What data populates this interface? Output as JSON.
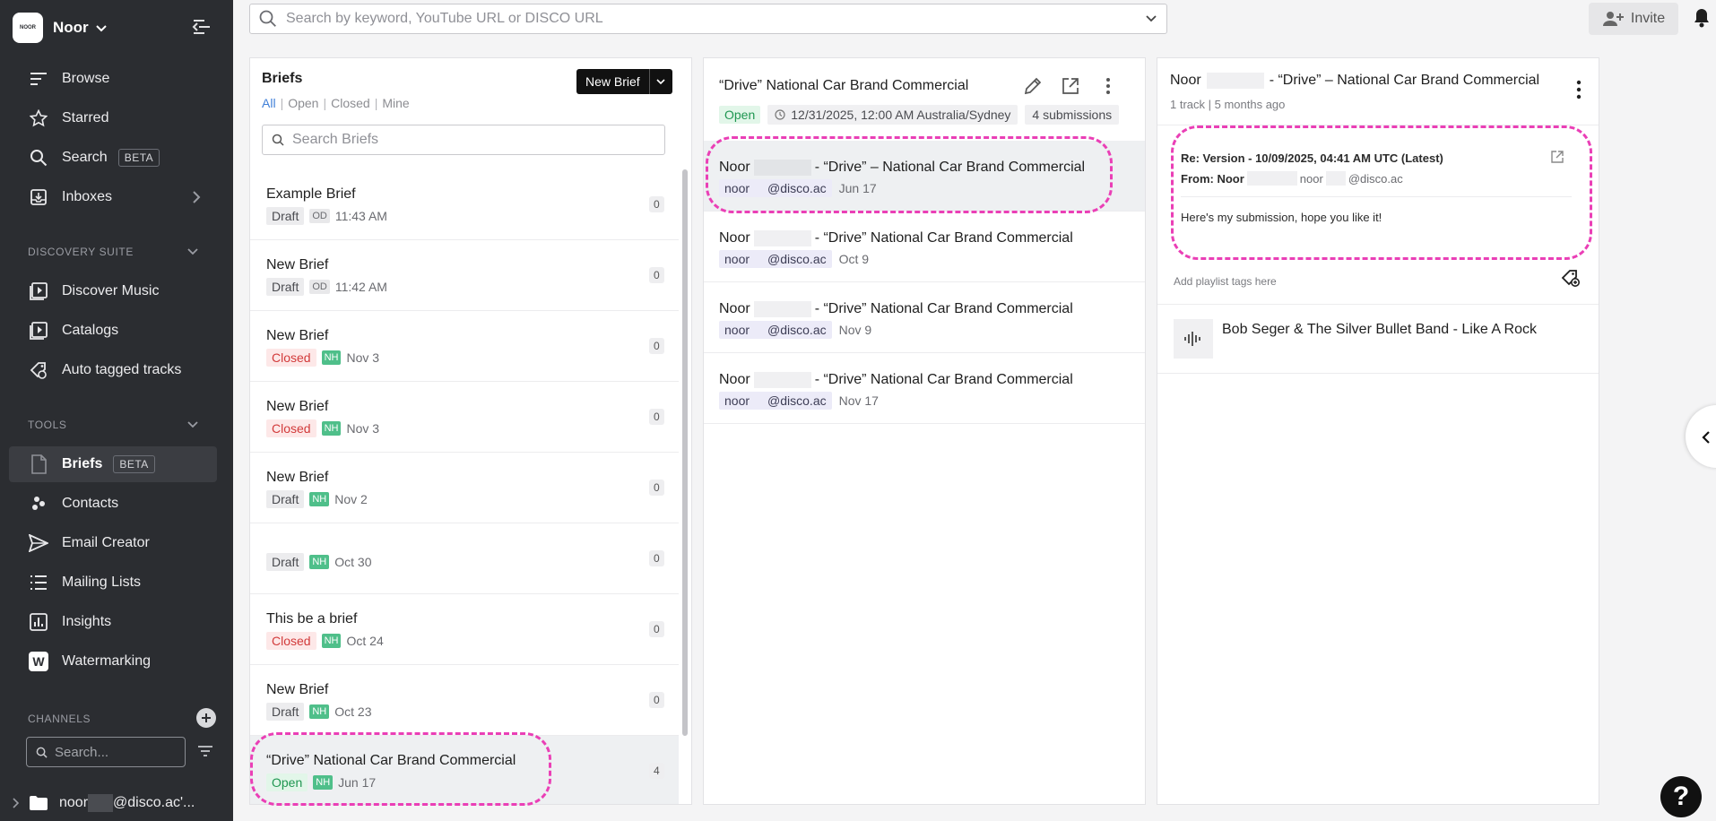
{
  "workspace": {
    "logo_text": "NOOR",
    "name": "Noor"
  },
  "sidebar": {
    "main_items": [
      {
        "label": "Browse",
        "icon": "browse-lines-icon"
      },
      {
        "label": "Starred",
        "icon": "star-icon"
      },
      {
        "label": "Search",
        "icon": "search-icon",
        "badge": "BETA"
      },
      {
        "label": "Inboxes",
        "icon": "inbox-icon"
      }
    ],
    "discovery_title": "DISCOVERY SUITE",
    "discovery_items": [
      {
        "label": "Discover Music",
        "icon": "discover-music-icon"
      },
      {
        "label": "Catalogs",
        "icon": "catalogs-icon"
      },
      {
        "label": "Auto tagged tracks",
        "icon": "auto-tag-icon"
      }
    ],
    "tools_title": "TOOLS",
    "tools_items": [
      {
        "label": "Briefs",
        "icon": "briefs-icon",
        "badge": "BETA",
        "active": true
      },
      {
        "label": "Contacts",
        "icon": "contacts-icon"
      },
      {
        "label": "Email Creator",
        "icon": "send-icon"
      },
      {
        "label": "Mailing Lists",
        "icon": "list-icon"
      },
      {
        "label": "Insights",
        "icon": "insights-icon"
      },
      {
        "label": "Watermarking",
        "icon": "watermark-icon",
        "icon_letter": "W"
      }
    ],
    "channels_title": "CHANNELS",
    "channel_search_placeholder": "Search...",
    "channel_item": {
      "prefix": "noor",
      "suffix": "@disco.ac'..."
    }
  },
  "topbar": {
    "search_placeholder": "Search by keyword, YouTube URL or DISCO URL",
    "invite_label": "Invite"
  },
  "briefs": {
    "title": "Briefs",
    "filters": [
      "All",
      "Open",
      "Closed",
      "Mine"
    ],
    "new_brief_label": "New Brief",
    "search_placeholder": "Search Briefs",
    "rows": [
      {
        "name": "Example Brief",
        "status": "Draft",
        "status_type": "draft",
        "avatar": "OD",
        "avatar_type": "od",
        "date": "11:43 AM",
        "count": "0"
      },
      {
        "name": "New Brief",
        "status": "Draft",
        "status_type": "draft",
        "avatar": "OD",
        "avatar_type": "od",
        "date": "11:42 AM",
        "count": "0"
      },
      {
        "name": "New Brief",
        "status": "Closed",
        "status_type": "closed",
        "avatar": "NH",
        "avatar_type": "nh",
        "date": "Nov 3",
        "count": "0"
      },
      {
        "name": "New Brief",
        "status": "Closed",
        "status_type": "closed",
        "avatar": "NH",
        "avatar_type": "nh",
        "date": "Nov 3",
        "count": "0"
      },
      {
        "name": "New Brief",
        "status": "Draft",
        "status_type": "draft",
        "avatar": "NH",
        "avatar_type": "nh",
        "date": "Nov 2",
        "count": "0"
      },
      {
        "name": "",
        "status": "Draft",
        "status_type": "draft",
        "avatar": "NH",
        "avatar_type": "nh",
        "date": "Oct 30",
        "count": "0"
      },
      {
        "name": "This be a brief",
        "status": "Closed",
        "status_type": "closed",
        "avatar": "NH",
        "avatar_type": "nh",
        "date": "Oct 24",
        "count": "0"
      },
      {
        "name": "New Brief",
        "status": "Draft",
        "status_type": "draft",
        "avatar": "NH",
        "avatar_type": "nh",
        "date": "Oct 23",
        "count": "0"
      },
      {
        "name": "“Drive” National Car Brand Commercial",
        "status": "Open",
        "status_type": "open",
        "avatar": "NH",
        "avatar_type": "nh",
        "date": "Jun 17",
        "count": "4",
        "selected": true
      }
    ]
  },
  "submissions": {
    "title": "“Drive” National Car Brand Commercial",
    "status": "Open",
    "deadline": "12/31/2025, 12:00 AM Australia/Sydney",
    "count_label": "4 submissions",
    "rows": [
      {
        "name_prefix": "Noor",
        "name_suffix": "- “Drive” – National Car Brand Commercial",
        "email_prefix": "noor",
        "email_suffix": "@disco.ac",
        "date": "Jun 17",
        "selected": true
      },
      {
        "name_prefix": "Noor",
        "name_suffix": "- “Drive” National Car Brand Commercial",
        "email_prefix": "noor",
        "email_suffix": "@disco.ac",
        "date": "Oct 9"
      },
      {
        "name_prefix": "Noor",
        "name_suffix": "- “Drive” National Car Brand Commercial",
        "email_prefix": "noor",
        "email_suffix": "@disco.ac",
        "date": "Nov 9"
      },
      {
        "name_prefix": "Noor",
        "name_suffix": "- “Drive” National Car Brand Commercial",
        "email_prefix": "noor",
        "email_suffix": "@disco.ac",
        "date": "Nov 17"
      }
    ]
  },
  "detail": {
    "title_prefix": "Noor",
    "title_suffix": "- “Drive” – National Car Brand Commercial",
    "subtitle": "1 track | 5 months ago",
    "message": {
      "re": "Re: Version - 10/09/2025, 04:41 AM UTC (Latest)",
      "from_label": "From: Noor",
      "from_email_prefix": "noor",
      "from_email_suffix": "@disco.ac",
      "body": "Here's my submission, hope you like it!"
    },
    "tags_hint": "Add playlist tags here",
    "track": "Bob Seger & The Silver Bullet Band - Like A Rock"
  },
  "help_label": "?",
  "colors": {
    "sidebar": "#2b2d31",
    "highlight": "#ea3fb6",
    "link": "#3f7fd8"
  }
}
